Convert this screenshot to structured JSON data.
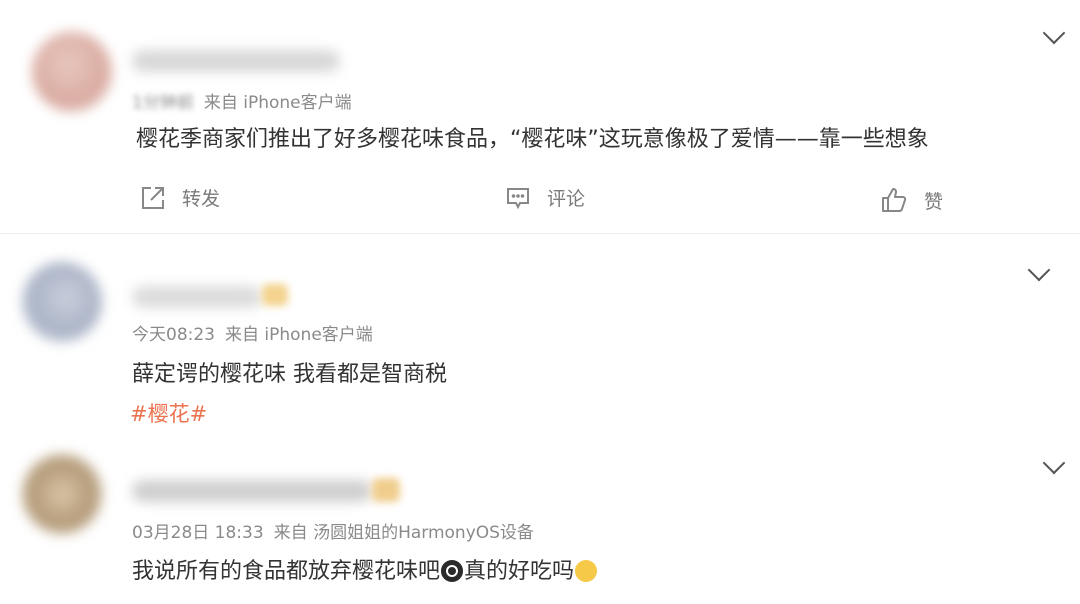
{
  "posts": [
    {
      "meta": {
        "time": "1分钟前",
        "source": "来自 iPhone客户端"
      },
      "content": "樱花季商家们推出了好多樱花味食品，“樱花味”这玩意像极了爱情——靠一些想象",
      "actions": {
        "repost": "转发",
        "comment": "评论",
        "like": "赞"
      }
    },
    {
      "meta": {
        "time": "今天08:23",
        "source": "来自 iPhone客户端"
      },
      "content": "薛定谔的樱花味 我看都是智商税",
      "tag": "#樱花#"
    },
    {
      "meta": {
        "time": "03月28日 18:33",
        "source": "来自 汤圆姐姐的HarmonyOS设备"
      },
      "content_before": "我说所有的食品都放弃樱花味吧",
      "content_middle": "真的好吃吗"
    }
  ],
  "colors": {
    "tag": "#eb7350",
    "meta": "#8a8a8a",
    "text": "#333333"
  },
  "icons": {
    "repost": "share-box-icon",
    "comment": "comment-bubble-icon",
    "like": "thumbs-up-icon",
    "more": "chevron-down-icon",
    "emoji1": "hear-no-evil-emoji-icon",
    "emoji2": "crying-face-emoji-icon"
  }
}
